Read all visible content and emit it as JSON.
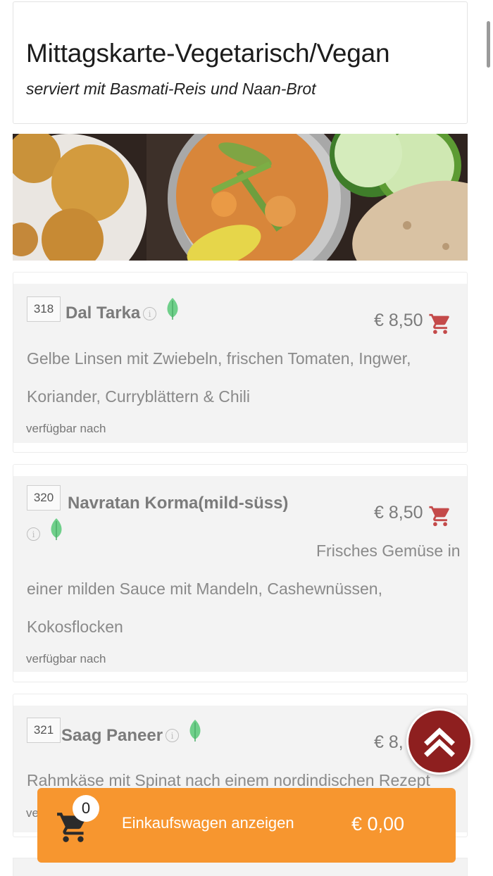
{
  "header": {
    "title": "Mittagskarte-Vegetarisch/Vegan",
    "subtitle": "serviert mit Basmati-Reis und Naan-Brot"
  },
  "items": [
    {
      "number": "318",
      "name": "Dal Tarka",
      "price": "€ 8,50",
      "description_lines": [
        "Gelbe Linsen mit Zwiebeln, frischen Tomaten, Ingwer,",
        "Koriander, Curryblättern & Chili"
      ],
      "availability": "verfügbar nach"
    },
    {
      "number": "320",
      "name": "Navratan Korma(mild-süss)",
      "price": "€ 8,50",
      "description_lines": [
        "Frisches Gemüse in",
        "einer milden Sauce mit Mandeln, Cashewnüssen,",
        "Kokosflocken"
      ],
      "availability": "verfügbar nach"
    },
    {
      "number": "321",
      "name": "Saag Paneer",
      "price": "€ 8,",
      "description_lines": [
        "Rahmkäse mit Spinat nach einem nordindischen Rezept"
      ],
      "availability": "ve"
    }
  ],
  "cart": {
    "count": "0",
    "label": "Einkaufswagen anzeigen",
    "total": "€ 0,00"
  },
  "colors": {
    "accent_orange": "#f7962f",
    "fab_red": "#8e1f1f",
    "cart_icon": "#c44a4a",
    "leaf_green": "#6fcf8a"
  },
  "icons": {
    "info": "info-icon",
    "vegan": "leaf-icon",
    "add_to_cart": "cart-icon",
    "scroll_top": "double-chevron-up-icon"
  }
}
